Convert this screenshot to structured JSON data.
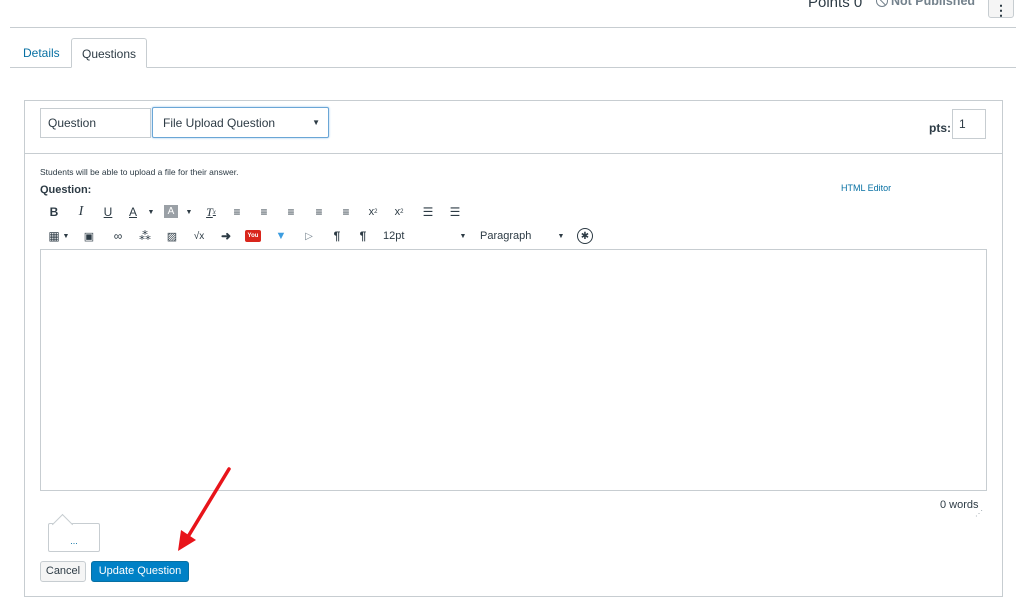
{
  "header": {
    "points_label": "Points",
    "points_value": "0",
    "status": "Not Published",
    "kebab_glyph": "⋮"
  },
  "tabs": [
    {
      "label": "Details",
      "active": false
    },
    {
      "label": "Questions",
      "active": true
    }
  ],
  "question": {
    "name_value": "Question",
    "type_selected": "File Upload Question",
    "pts_label": "pts:",
    "pts_value": "1",
    "help_text": "Students will be able to upload a file for their answer.",
    "label": "Question:",
    "html_editor_link": "HTML Editor"
  },
  "toolbar": {
    "row1": [
      {
        "icon": "bold-icon",
        "glyph": "B"
      },
      {
        "icon": "italic-icon",
        "glyph": "I"
      },
      {
        "icon": "underline-icon",
        "glyph": "U"
      },
      {
        "icon": "text-color-icon",
        "glyph": "A"
      },
      {
        "icon": "background-color-icon",
        "glyph": "A"
      },
      {
        "icon": "clear-formatting-icon",
        "glyph": "T"
      },
      {
        "icon": "align-left-icon",
        "glyph": "≡"
      },
      {
        "icon": "align-center-icon",
        "glyph": "≡"
      },
      {
        "icon": "align-right-icon",
        "glyph": "≡"
      },
      {
        "icon": "outdent-icon",
        "glyph": "≡"
      },
      {
        "icon": "indent-icon",
        "glyph": "≡"
      },
      {
        "icon": "superscript-icon",
        "glyph": "x²"
      },
      {
        "icon": "subscript-icon",
        "glyph": "x₂"
      },
      {
        "icon": "bullet-list-icon",
        "glyph": "☰"
      },
      {
        "icon": "numbered-list-icon",
        "glyph": "☰"
      }
    ],
    "row2": [
      {
        "icon": "table-icon",
        "glyph": "▦"
      },
      {
        "icon": "media-icon",
        "glyph": "▣"
      },
      {
        "icon": "link-icon",
        "glyph": "🔗"
      },
      {
        "icon": "unlink-icon",
        "glyph": "⛓"
      },
      {
        "icon": "image-icon",
        "glyph": "▨"
      },
      {
        "icon": "equation-icon",
        "glyph": "√x"
      },
      {
        "icon": "lti-tool-icon",
        "glyph": "➜"
      },
      {
        "icon": "youtube-icon",
        "glyph": "You"
      },
      {
        "icon": "vimeo-icon",
        "glyph": "V"
      },
      {
        "icon": "video-icon",
        "glyph": "▷"
      },
      {
        "icon": "ltr-icon",
        "glyph": "¶"
      },
      {
        "icon": "rtl-icon",
        "glyph": "¶"
      }
    ],
    "font_size": "12pt",
    "block_format": "Paragraph",
    "accessibility_glyph": "♿"
  },
  "editor": {
    "word_count": "0 words"
  },
  "actions": {
    "callout_text": "...",
    "cancel_label": "Cancel",
    "update_label": "Update Question"
  },
  "colors": {
    "link": "#0770a3",
    "primary_button": "#0081c6",
    "border": "#c7cdd1",
    "annotation_arrow": "#e8141a"
  }
}
